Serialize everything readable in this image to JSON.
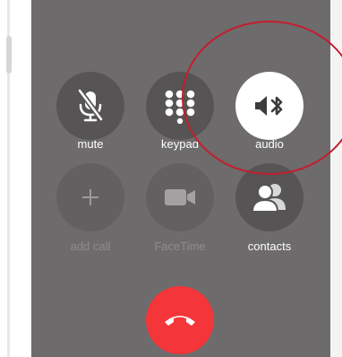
{
  "call_controls": {
    "mute_label": "mute",
    "keypad_label": "keypad",
    "audio_label": "audio",
    "add_call_label": "add call",
    "facetime_label": "FaceTime",
    "contacts_label": "contacts"
  },
  "state": {
    "audio_active": true,
    "add_call_enabled": false,
    "facetime_enabled": false
  },
  "colors": {
    "screen_background": "#6d6b6b",
    "button_background": "#565454",
    "active_button": "#ffffff",
    "end_call": "#f4363a",
    "annotation_circle": "#c41e2e"
  },
  "icons": {
    "mute": "mic-slash-icon",
    "keypad": "keypad-grid-icon",
    "audio": "speaker-bluetooth-icon",
    "add_call": "plus-icon",
    "facetime": "video-camera-icon",
    "contacts": "contacts-icon",
    "end_call": "phone-hangup-icon"
  }
}
